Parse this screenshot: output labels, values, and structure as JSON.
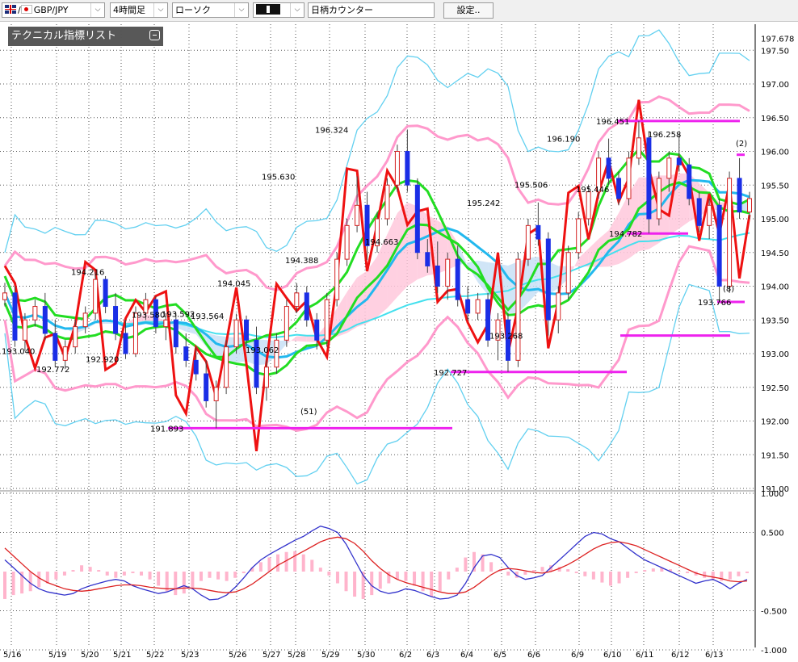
{
  "toolbar": {
    "pair": "GBP/JPY",
    "timeframe": "4時間足",
    "chart_type": "ローソク",
    "counter": "日柄カウンター",
    "settings": "設定..",
    "flag_icons": [
      "uk-flag-icon",
      "japan-flag-icon"
    ],
    "dropdown_icon": "chevron-down-icon"
  },
  "panel": {
    "title": "テクニカル指標リスト"
  },
  "colors": {
    "up": "#d42222",
    "down": "#1a2ee6",
    "bb_outer": "#62d0f0",
    "bb_inner": "#ff99cc",
    "ma_green": "#22dd22",
    "ma_blue": "#22b8ee",
    "ma_long": "#44e0ee",
    "rci": "#ee1111",
    "cloud_up": "#ffc8dc",
    "cloud_down": "#c8e0f6",
    "line_magenta": "#ee22ee",
    "macd": "#3333cc",
    "signal": "#dd2222",
    "hist": "#ffb4cc"
  },
  "chart_data": [
    {
      "type": "candlestick",
      "y_axis": {
        "ylim": [
          191.0,
          197.8
        ],
        "ticks": [
          "197.50",
          "197.00",
          "196.50",
          "196.00",
          "195.50",
          "195.00",
          "194.50",
          "194.00",
          "193.50",
          "193.00",
          "192.50",
          "192.00",
          "191.50",
          "191.00"
        ],
        "last_label": "197.678"
      },
      "x_axis": {
        "labels": [
          "5/16",
          "5/19",
          "5/20",
          "5/21",
          "5/22",
          "5/23",
          "5/26",
          "5/27",
          "5/28",
          "5/29",
          "5/30",
          "6/2",
          "6/3",
          "6/4",
          "6/5",
          "6/6",
          "6/9",
          "6/10",
          "6/11",
          "6/12",
          "6/13"
        ]
      },
      "grid": true,
      "price_labels": [
        {
          "text": "193.040",
          "value": 193.04
        },
        {
          "text": "192.772",
          "value": 192.772
        },
        {
          "text": "194.216",
          "value": 194.216
        },
        {
          "text": "192.920",
          "value": 192.92
        },
        {
          "text": "193.580",
          "value": 193.58
        },
        {
          "text": "193.592",
          "value": 193.592
        },
        {
          "text": "193.564",
          "value": 193.564
        },
        {
          "text": "191.893",
          "value": 191.893
        },
        {
          "text": "194.045",
          "value": 194.045
        },
        {
          "text": "193.062",
          "value": 193.062
        },
        {
          "text": "195.630",
          "value": 195.63
        },
        {
          "text": "196.324",
          "value": 196.324
        },
        {
          "text": "194.388",
          "value": 194.388
        },
        {
          "text": "194.663",
          "value": 194.663
        },
        {
          "text": "192.727",
          "value": 192.727
        },
        {
          "text": "195.242",
          "value": 195.242
        },
        {
          "text": "193.268",
          "value": 193.268
        },
        {
          "text": "195.506",
          "value": 195.506
        },
        {
          "text": "196.190",
          "value": 196.19
        },
        {
          "text": "195.446",
          "value": 195.446
        },
        {
          "text": "196.451",
          "value": 196.451
        },
        {
          "text": "194.782",
          "value": 194.782
        },
        {
          "text": "196.258",
          "value": 196.258
        },
        {
          "text": "193.766",
          "value": 193.766
        }
      ],
      "count_labels": [
        "(51)",
        "(2)",
        "(8)"
      ],
      "levels": [
        {
          "value": 191.893
        },
        {
          "value": 192.727
        },
        {
          "value": 193.268
        },
        {
          "value": 194.782
        },
        {
          "value": 196.451
        },
        {
          "value": 195.95
        },
        {
          "value": 193.766
        }
      ],
      "candles_ohlc": [
        [
          193.8,
          194.05,
          193.7,
          193.9
        ],
        [
          193.9,
          194.0,
          193.1,
          193.2
        ],
        [
          193.2,
          193.6,
          193.04,
          193.5
        ],
        [
          193.5,
          193.8,
          193.4,
          193.7
        ],
        [
          193.7,
          193.9,
          193.2,
          193.3
        ],
        [
          193.3,
          193.5,
          192.8,
          192.9
        ],
        [
          192.9,
          193.2,
          192.77,
          193.1
        ],
        [
          193.1,
          193.5,
          193.0,
          193.4
        ],
        [
          193.4,
          193.7,
          193.3,
          193.6
        ],
        [
          193.6,
          194.216,
          193.5,
          194.1
        ],
        [
          194.1,
          194.15,
          193.6,
          193.7
        ],
        [
          193.7,
          193.9,
          193.2,
          193.3
        ],
        [
          193.3,
          193.5,
          192.92,
          193.0
        ],
        [
          193.0,
          193.7,
          192.95,
          193.6
        ],
        [
          193.6,
          193.9,
          193.5,
          193.8
        ],
        [
          193.8,
          193.85,
          193.3,
          193.4
        ],
        [
          193.4,
          193.6,
          193.2,
          193.5
        ],
        [
          193.5,
          193.6,
          193.0,
          193.1
        ],
        [
          193.1,
          193.3,
          192.8,
          192.9
        ],
        [
          192.9,
          193.1,
          192.6,
          192.7
        ],
        [
          192.7,
          192.9,
          192.2,
          192.3
        ],
        [
          192.3,
          192.6,
          191.893,
          192.5
        ],
        [
          192.5,
          193.2,
          192.4,
          193.1
        ],
        [
          193.1,
          193.592,
          193.0,
          193.5
        ],
        [
          193.5,
          193.564,
          193.1,
          193.2
        ],
        [
          193.2,
          193.4,
          192.4,
          192.5
        ],
        [
          192.5,
          192.9,
          192.3,
          192.8
        ],
        [
          192.8,
          193.3,
          192.7,
          193.2
        ],
        [
          193.2,
          193.8,
          193.1,
          193.7
        ],
        [
          193.7,
          194.045,
          193.6,
          193.9
        ],
        [
          193.9,
          194.0,
          193.4,
          193.5
        ],
        [
          193.5,
          193.6,
          193.062,
          193.2
        ],
        [
          193.2,
          193.9,
          193.1,
          193.8
        ],
        [
          193.8,
          194.5,
          193.7,
          194.4
        ],
        [
          194.4,
          195.0,
          194.3,
          194.9
        ],
        [
          194.9,
          195.63,
          194.8,
          195.2
        ],
        [
          195.2,
          195.4,
          194.388,
          194.6
        ],
        [
          194.6,
          195.1,
          194.5,
          195.0
        ],
        [
          195.0,
          195.6,
          194.9,
          195.5
        ],
        [
          195.5,
          196.1,
          195.4,
          196.0
        ],
        [
          196.0,
          196.324,
          195.4,
          195.5
        ],
        [
          195.5,
          195.6,
          194.4,
          194.5
        ],
        [
          194.5,
          194.7,
          194.2,
          194.3
        ],
        [
          194.3,
          194.663,
          193.9,
          194.0
        ],
        [
          194.0,
          194.5,
          193.8,
          194.4
        ],
        [
          194.4,
          194.6,
          193.7,
          193.8
        ],
        [
          193.8,
          194.0,
          193.5,
          193.6
        ],
        [
          193.6,
          193.9,
          193.5,
          193.8
        ],
        [
          193.8,
          193.9,
          193.1,
          193.2
        ],
        [
          193.2,
          193.6,
          192.9,
          193.5
        ],
        [
          193.5,
          193.6,
          192.727,
          192.9
        ],
        [
          192.9,
          194.5,
          192.8,
          194.4
        ],
        [
          194.4,
          195.0,
          194.3,
          194.9
        ],
        [
          194.9,
          195.242,
          194.6,
          194.7
        ],
        [
          194.7,
          194.8,
          193.268,
          193.5
        ],
        [
          193.5,
          194.0,
          193.3,
          193.9
        ],
        [
          193.9,
          194.6,
          193.8,
          194.5
        ],
        [
          194.5,
          195.1,
          194.4,
          195.0
        ],
        [
          195.0,
          195.506,
          194.9,
          195.4
        ],
        [
          195.4,
          196.0,
          195.3,
          195.9
        ],
        [
          195.9,
          196.19,
          195.5,
          195.6
        ],
        [
          195.6,
          195.7,
          195.2,
          195.3
        ],
        [
          195.3,
          196.0,
          195.2,
          195.9
        ],
        [
          195.9,
          196.451,
          195.8,
          196.2
        ],
        [
          196.2,
          196.3,
          194.782,
          195.0
        ],
        [
          195.0,
          195.7,
          194.9,
          195.6
        ],
        [
          195.6,
          196.0,
          195.4,
          195.9
        ],
        [
          195.9,
          196.258,
          195.7,
          195.8
        ],
        [
          195.8,
          195.9,
          195.2,
          195.3
        ],
        [
          195.3,
          195.4,
          194.8,
          194.9
        ],
        [
          194.9,
          195.3,
          194.7,
          195.2
        ],
        [
          195.2,
          195.3,
          193.766,
          194.0
        ],
        [
          194.0,
          195.7,
          193.9,
          195.6
        ],
        [
          195.6,
          195.9,
          195.0,
          195.1
        ],
        [
          195.1,
          195.4,
          195.0,
          195.3
        ]
      ]
    },
    {
      "type": "line",
      "series": [
        {
          "name": "MACD"
        },
        {
          "name": "Signal"
        }
      ],
      "y_axis": {
        "ylim": [
          -1.0,
          1.0
        ],
        "ticks": [
          "1.000",
          "0.500",
          "-0.500",
          "-1.000"
        ]
      },
      "hist": [
        -0.35,
        -0.3,
        -0.28,
        -0.25,
        -0.2,
        -0.15,
        -0.1,
        -0.05,
        0.02,
        0.08,
        0.06,
        0.02,
        -0.05,
        -0.08,
        -0.05,
        -0.02,
        -0.05,
        -0.1,
        -0.18,
        -0.25,
        -0.3,
        -0.28,
        -0.2,
        -0.12,
        -0.08,
        -0.1,
        -0.12,
        -0.08,
        -0.02,
        0.05,
        0.12,
        0.18,
        0.22,
        0.25,
        0.26,
        0.22,
        0.15,
        0.05,
        -0.05,
        -0.15,
        -0.25,
        -0.32,
        -0.35,
        -0.3,
        -0.22,
        -0.15,
        -0.1,
        -0.12,
        -0.18,
        -0.25,
        -0.32,
        -0.25,
        -0.1,
        0.05,
        0.18,
        0.25,
        0.22,
        0.12,
        0.02,
        -0.05,
        -0.08,
        -0.04,
        0.02,
        0.06,
        0.08,
        0.06,
        0.03,
        -0.02,
        -0.06,
        -0.1,
        -0.14,
        -0.18,
        -0.15,
        -0.08,
        -0.02,
        0.02,
        0.04,
        0.05,
        0.03,
        0.01,
        -0.02,
        -0.05,
        -0.08,
        -0.1,
        -0.12,
        -0.1,
        -0.06,
        -0.02
      ],
      "macd": [
        0.15,
        0.05,
        -0.05,
        -0.15,
        -0.22,
        -0.26,
        -0.28,
        -0.3,
        -0.28,
        -0.22,
        -0.18,
        -0.15,
        -0.12,
        -0.1,
        -0.12,
        -0.18,
        -0.22,
        -0.25,
        -0.28,
        -0.26,
        -0.22,
        -0.18,
        -0.22,
        -0.3,
        -0.36,
        -0.35,
        -0.3,
        -0.2,
        -0.08,
        0.05,
        0.15,
        0.22,
        0.28,
        0.34,
        0.4,
        0.45,
        0.52,
        0.58,
        0.55,
        0.5,
        0.35,
        0.15,
        -0.05,
        -0.18,
        -0.25,
        -0.28,
        -0.26,
        -0.22,
        -0.24,
        -0.28,
        -0.32,
        -0.35,
        -0.34,
        -0.3,
        -0.15,
        0.05,
        0.2,
        0.22,
        0.18,
        0.05,
        -0.05,
        -0.1,
        -0.08,
        -0.05,
        0.05,
        0.15,
        0.25,
        0.35,
        0.45,
        0.5,
        0.48,
        0.42,
        0.38,
        0.3,
        0.22,
        0.15,
        0.1,
        0.05,
        0.0,
        -0.05,
        -0.1,
        -0.15,
        -0.12,
        -0.1,
        -0.15,
        -0.22,
        -0.15,
        -0.1
      ],
      "signal": [
        0.3,
        0.2,
        0.1,
        0.0,
        -0.08,
        -0.14,
        -0.18,
        -0.22,
        -0.24,
        -0.25,
        -0.24,
        -0.22,
        -0.2,
        -0.18,
        -0.17,
        -0.17,
        -0.18,
        -0.2,
        -0.21,
        -0.22,
        -0.22,
        -0.21,
        -0.21,
        -0.22,
        -0.24,
        -0.26,
        -0.27,
        -0.26,
        -0.22,
        -0.16,
        -0.08,
        0.0,
        0.08,
        0.14,
        0.2,
        0.26,
        0.32,
        0.38,
        0.42,
        0.44,
        0.42,
        0.36,
        0.26,
        0.14,
        0.04,
        -0.04,
        -0.1,
        -0.14,
        -0.17,
        -0.2,
        -0.23,
        -0.26,
        -0.28,
        -0.28,
        -0.26,
        -0.2,
        -0.12,
        -0.04,
        0.02,
        0.04,
        0.03,
        0.01,
        -0.01,
        -0.02,
        0.0,
        0.04,
        0.09,
        0.15,
        0.22,
        0.29,
        0.34,
        0.37,
        0.38,
        0.36,
        0.33,
        0.28,
        0.23,
        0.18,
        0.13,
        0.08,
        0.03,
        -0.02,
        -0.05,
        -0.07,
        -0.09,
        -0.12,
        -0.13,
        -0.12
      ]
    }
  ]
}
